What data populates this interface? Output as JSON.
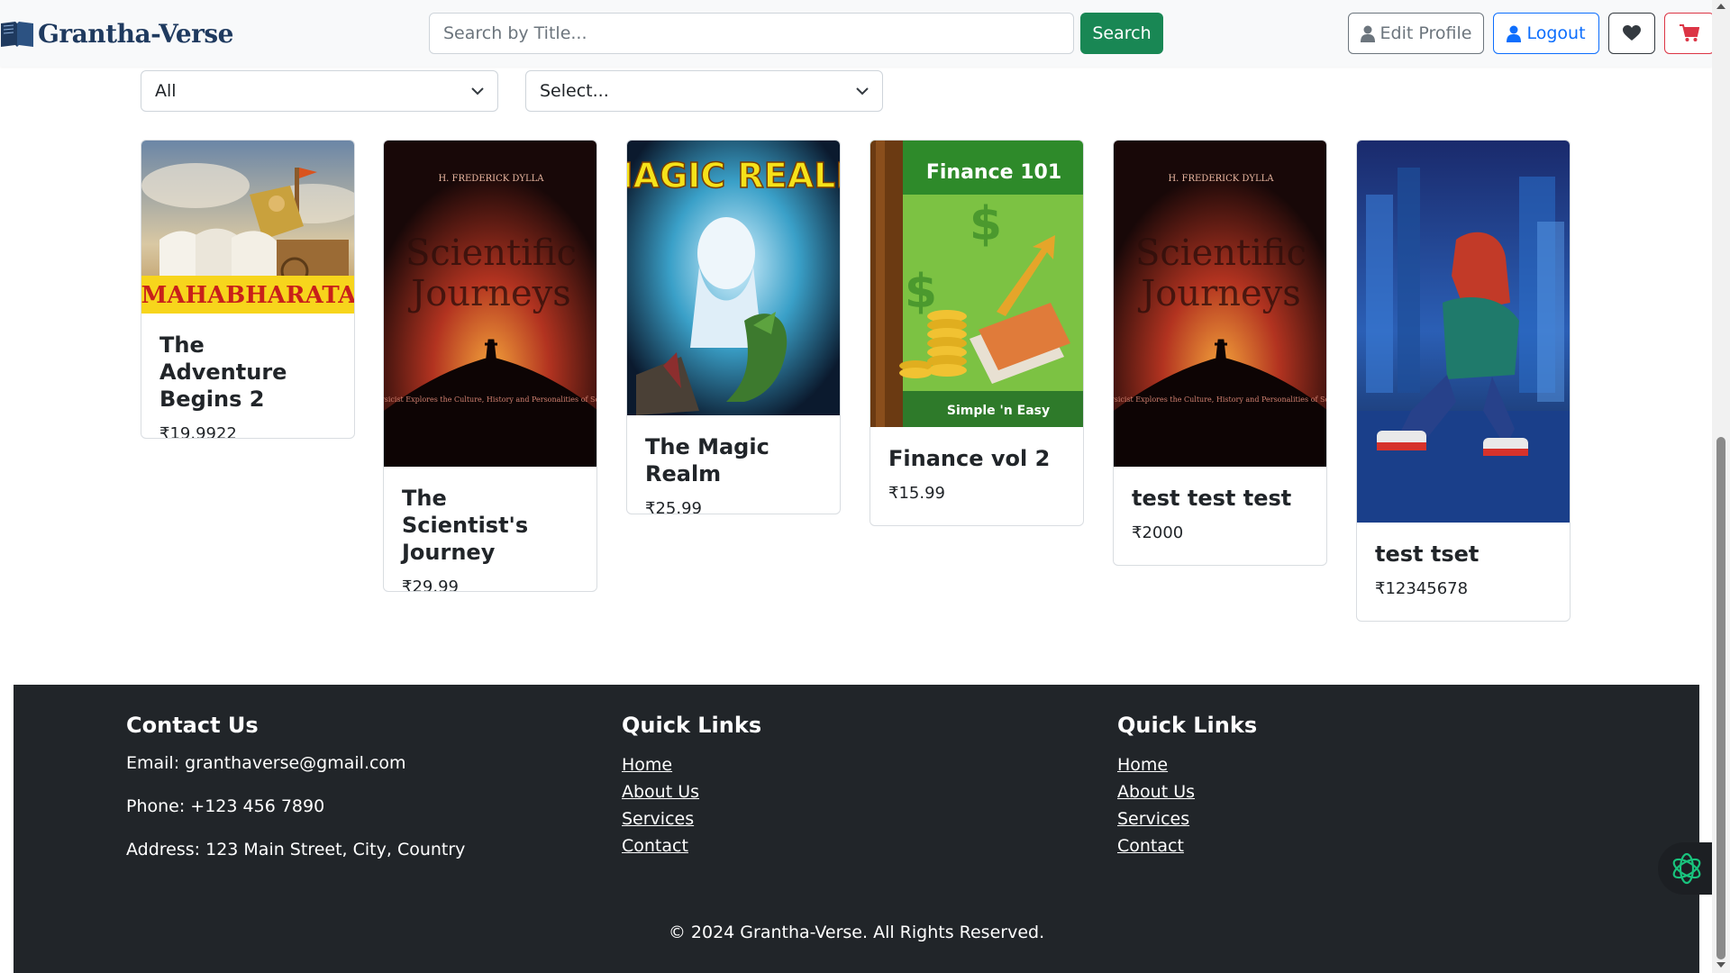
{
  "navbar": {
    "brand": "Grantha-Verse",
    "search": {
      "placeholder": "Search by Title...",
      "value": "",
      "button_label": "Search"
    },
    "edit_profile_label": "Edit Profile",
    "logout_label": "Logout"
  },
  "filters": {
    "category": "All",
    "sort": "Select..."
  },
  "books": [
    {
      "title": "The Adventure Begins 2",
      "price": "₹19.9922",
      "cover_text": "MAHABHARATA"
    },
    {
      "title": "The Scientist's Journey",
      "price": "₹29.99",
      "cover_author": "H. FREDERICK DYLLA",
      "cover_title_1": "Scientific",
      "cover_title_2": "Journeys",
      "cover_sub": "A Physicist Explores the Culture, History and Personalities of Science"
    },
    {
      "title": "The Magic Realm",
      "price": "₹25.99",
      "cover_text": "MAGIC REALM"
    },
    {
      "title": "Finance vol 2",
      "price": "₹15.99",
      "cover_text": "Finance 101",
      "cover_tag": "Simple 'n Easy"
    },
    {
      "title": "test test test",
      "price": "₹2000",
      "cover_author": "H. FREDERICK DYLLA",
      "cover_title_1": "Scientific",
      "cover_title_2": "Journeys",
      "cover_sub": "A Physicist Explores the Culture, History and Personalities of Science"
    },
    {
      "title": "test tset",
      "price": "₹12345678"
    }
  ],
  "footer": {
    "contact": {
      "heading": "Contact Us",
      "email": "Email: granthaverse@gmail.com",
      "phone": "Phone: +123 456 7890",
      "address": "Address: 123 Main Street, City, Country"
    },
    "quick_links_1": {
      "heading": "Quick Links",
      "links": [
        "Home",
        "About Us",
        "Services",
        "Contact"
      ]
    },
    "quick_links_2": {
      "heading": "Quick Links",
      "links": [
        "Home",
        "About Us",
        "Services",
        "Contact"
      ]
    },
    "copyright": "© 2024 Grantha-Verse. All Rights Reserved."
  },
  "colors": {
    "success": "#198754",
    "primary": "#0d6efd",
    "danger": "#dc3545",
    "footer_bg": "#212529",
    "brand": "#1f3a5f"
  },
  "icons": [
    "book-icon",
    "user-icon",
    "heart-icon",
    "cart-icon",
    "chevron-down-icon",
    "chat-assistant-icon"
  ]
}
